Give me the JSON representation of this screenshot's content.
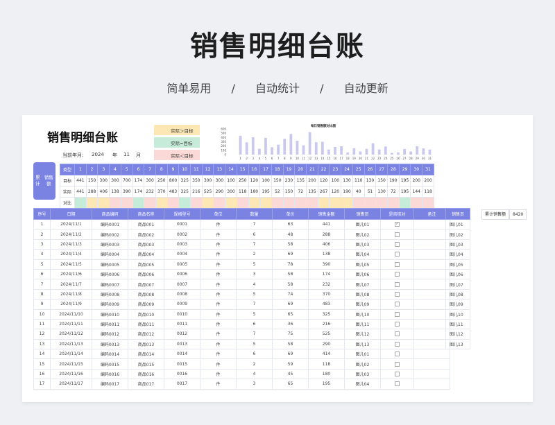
{
  "hero": {
    "title": "销售明细台账",
    "sub1": "简单易用",
    "sub2": "自动统计",
    "sub3": "自动更新",
    "sep": "/"
  },
  "sheet": {
    "title": "销售明细台账",
    "ym_label": "当前年月:",
    "year": "2024",
    "year_unit": "年",
    "month": "11",
    "month_unit": "月",
    "cum_button": "累计\n销售额"
  },
  "legend": {
    "gt": "实际＞目标",
    "eq": "实际=目标",
    "lt": "实际＜目标",
    "colors": {
      "gt": "#fde7b4",
      "eq": "#c6ecd9",
      "lt": "#fbd9d6"
    }
  },
  "target_table": {
    "row_labels": [
      "类型",
      "目标",
      "实际",
      "对比"
    ],
    "days": [
      "1",
      "2",
      "3",
      "4",
      "5",
      "6",
      "7",
      "8",
      "9",
      "10",
      "11",
      "12",
      "13",
      "14",
      "15",
      "16",
      "17",
      "18",
      "19",
      "20",
      "21",
      "22",
      "23",
      "24",
      "25",
      "26",
      "27",
      "28",
      "29",
      "30",
      "31"
    ],
    "targets": [
      "441",
      "150",
      "300",
      "300",
      "700",
      "174",
      "300",
      "250",
      "800",
      "325",
      "350",
      "300",
      "300",
      "100",
      "250",
      "120",
      "100",
      "150",
      "230",
      "135",
      "200",
      "120",
      "100",
      "130",
      "110",
      "130",
      "150",
      "190",
      "195",
      "200",
      "200"
    ],
    "actuals": [
      "441",
      "288",
      "406",
      "138",
      "390",
      "174",
      "232",
      "370",
      "483",
      "325",
      "216",
      "525",
      "290",
      "300",
      "118",
      "180",
      "195",
      "52",
      "150",
      "72",
      "135",
      "267",
      "120",
      "190",
      "40",
      "51",
      "130",
      "72",
      "195",
      "144",
      "118"
    ],
    "compare": [
      "eq",
      "",
      "",
      "",
      "",
      "eq",
      "",
      "",
      "",
      "eq",
      "",
      "",
      "",
      "",
      "",
      "",
      "",
      "",
      "",
      "",
      "",
      "",
      "",
      "",
      "",
      "",
      "eq",
      "",
      "eq",
      "",
      ""
    ]
  },
  "chart_data": {
    "type": "bar",
    "title": "每日销售额对比图",
    "categories": [
      "1",
      "2",
      "3",
      "4",
      "5",
      "6",
      "7",
      "8",
      "9",
      "10",
      "11",
      "12",
      "13",
      "14",
      "15",
      "16",
      "17",
      "18",
      "19",
      "20",
      "21",
      "22",
      "23",
      "24",
      "25",
      "26",
      "27",
      "28",
      "29",
      "30",
      "31"
    ],
    "values": [
      441,
      288,
      406,
      138,
      390,
      174,
      232,
      370,
      483,
      325,
      216,
      525,
      290,
      300,
      118,
      180,
      195,
      52,
      150,
      72,
      135,
      267,
      120,
      190,
      40,
      51,
      130,
      72,
      195,
      144,
      118
    ],
    "yticks": [
      "0",
      "100",
      "200",
      "300",
      "400",
      "500",
      "600"
    ],
    "ylim": [
      0,
      600
    ],
    "bar_color": "#c9c9ef"
  },
  "main_table": {
    "headers": [
      "序号",
      "日期",
      "商品编码",
      "商品名称",
      "规格型号",
      "单位",
      "数量",
      "单价",
      "销售金额",
      "销售员",
      "是否核对",
      "备注"
    ],
    "rows": [
      [
        "1",
        "2024/11/1",
        "编码0001",
        "商品001",
        "0001",
        "件",
        "7",
        "63",
        "441",
        "图儿01",
        "✓",
        ""
      ],
      [
        "2",
        "2024/11/2",
        "编码0002",
        "商品002",
        "0002",
        "件",
        "6",
        "48",
        "288",
        "图儿02",
        "",
        ""
      ],
      [
        "3",
        "2024/11/3",
        "编码0003",
        "商品003",
        "0003",
        "件",
        "7",
        "58",
        "406",
        "图儿03",
        "",
        ""
      ],
      [
        "4",
        "2024/11/4",
        "编码0004",
        "商品004",
        "0004",
        "件",
        "2",
        "69",
        "138",
        "图儿04",
        "",
        ""
      ],
      [
        "5",
        "2024/11/5",
        "编码0005",
        "商品005",
        "0005",
        "件",
        "5",
        "78",
        "390",
        "图儿05",
        "",
        ""
      ],
      [
        "6",
        "2024/11/6",
        "编码0006",
        "商品006",
        "0006",
        "件",
        "3",
        "58",
        "174",
        "图儿06",
        "",
        ""
      ],
      [
        "7",
        "2024/11/7",
        "编码0007",
        "商品007",
        "0007",
        "件",
        "4",
        "58",
        "232",
        "图儿07",
        "",
        ""
      ],
      [
        "8",
        "2024/11/8",
        "编码0008",
        "商品008",
        "0008",
        "件",
        "5",
        "74",
        "370",
        "图儿08",
        "",
        ""
      ],
      [
        "9",
        "2024/11/9",
        "编码0009",
        "商品009",
        "0009",
        "件",
        "7",
        "69",
        "483",
        "图儿09",
        "",
        ""
      ],
      [
        "10",
        "2024/11/10",
        "编码0010",
        "商品010",
        "0010",
        "件",
        "5",
        "65",
        "325",
        "图儿10",
        "",
        ""
      ],
      [
        "11",
        "2024/11/11",
        "编码0011",
        "商品011",
        "0011",
        "件",
        "6",
        "36",
        "216",
        "图儿11",
        "",
        ""
      ],
      [
        "12",
        "2024/11/12",
        "编码0012",
        "商品012",
        "0012",
        "件",
        "7",
        "75",
        "525",
        "图儿12",
        "",
        ""
      ],
      [
        "13",
        "2024/11/13",
        "编码0013",
        "商品013",
        "0013",
        "件",
        "5",
        "58",
        "290",
        "图儿13",
        "",
        ""
      ],
      [
        "14",
        "2024/11/14",
        "编码0014",
        "商品014",
        "0014",
        "件",
        "6",
        "69",
        "414",
        "图儿01",
        "",
        ""
      ],
      [
        "15",
        "2024/11/15",
        "编码0015",
        "商品015",
        "0015",
        "件",
        "2",
        "59",
        "118",
        "图儿02",
        "",
        ""
      ],
      [
        "16",
        "2024/11/16",
        "编码0016",
        "商品016",
        "0016",
        "件",
        "4",
        "45",
        "180",
        "图儿03",
        "",
        ""
      ],
      [
        "17",
        "2024/11/17",
        "编码0017",
        "商品017",
        "0017",
        "件",
        "3",
        "65",
        "195",
        "图儿04",
        "",
        ""
      ]
    ]
  },
  "side_table": {
    "header": "销售员",
    "names": [
      "图儿01",
      "图儿02",
      "图儿03",
      "图儿04",
      "图儿05",
      "图儿06",
      "图儿07",
      "图儿08",
      "图儿09",
      "图儿10",
      "图儿11",
      "图儿12",
      "图儿13"
    ]
  },
  "totals": {
    "label": "累计销售额",
    "value": "8420"
  }
}
